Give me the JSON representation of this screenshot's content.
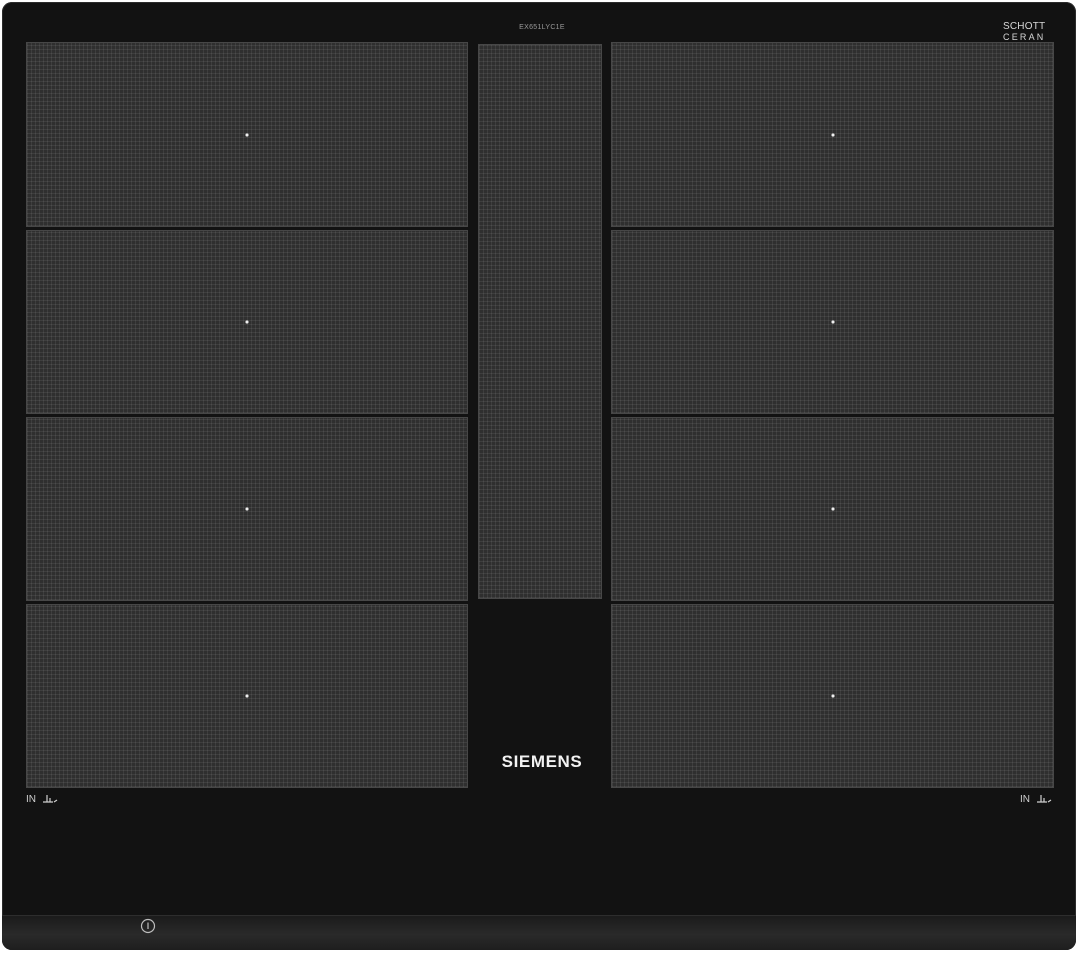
{
  "hob": {
    "model_code": "EX651LYC1E",
    "glass_brand": {
      "line1": "SCHOTT",
      "line2": "CERAN"
    },
    "brand_logo": "SIEMENS",
    "left_zone_label": "IN",
    "right_zone_label": "IN",
    "icons": {
      "zone_indicator": "pot-position-icon",
      "power": "power-info-icon"
    },
    "colors": {
      "frame": "#121212",
      "zone_surface": "#2f2f2f",
      "text": "#f2f2f2"
    }
  }
}
